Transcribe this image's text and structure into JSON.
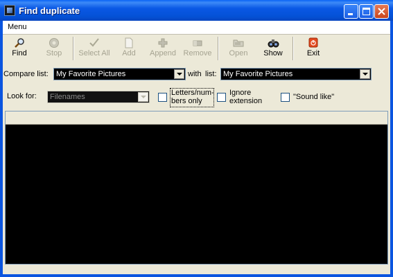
{
  "window": {
    "title": "Find duplicate"
  },
  "menu": {
    "label": "Menu"
  },
  "toolbar": {
    "find": "Find",
    "stop": "Stop",
    "select_all": "Select All",
    "add": "Add",
    "append": "Append",
    "remove": "Remove",
    "open": "Open",
    "show": "Show",
    "exit": "Exit"
  },
  "compare": {
    "label": "Compare list:",
    "list1_value": "My Favorite Pictures",
    "with_label": "with",
    "list_label": "list:",
    "list2_value": "My Favorite Pictures"
  },
  "lookfor": {
    "label": "Look for:",
    "value": "Filenames",
    "letters_line1": "Letters/num-",
    "letters_line2": "bers only",
    "ignore_line1": "Ignore",
    "ignore_line2": "extension",
    "sound_like": "\"Sound like\""
  }
}
